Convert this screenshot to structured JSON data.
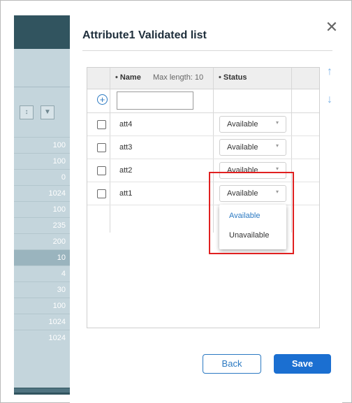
{
  "dialog": {
    "title": "Attribute1 Validated list",
    "close_glyph": "✕"
  },
  "grid": {
    "header": {
      "required_mark": "•",
      "name_label": "Name",
      "max_length_label": "Max length: 10",
      "status_label": "Status"
    },
    "add_glyph": "+",
    "new_name_value": "",
    "rows": [
      {
        "name": "att4",
        "status": "Available"
      },
      {
        "name": "att3",
        "status": "Available"
      },
      {
        "name": "att2",
        "status": "Available"
      },
      {
        "name": "att1",
        "status": "Available"
      }
    ],
    "dropdown": {
      "options": [
        "Available",
        "Unavailable"
      ],
      "highlighted": "Available"
    },
    "chevron_glyph": "▾"
  },
  "side_arrows": {
    "up_glyph": "↑",
    "down_glyph": "↓"
  },
  "buttons": {
    "back_label": "Back",
    "save_label": "Save"
  },
  "background_sheet": {
    "values": [
      "100",
      "100",
      "0",
      "1024",
      "100",
      "235",
      "200",
      "10",
      "4",
      "30",
      "100",
      "1024",
      "1024"
    ],
    "selected_value": "10",
    "filter_icon": "filter-icon",
    "sort_icon": "sort-icon"
  },
  "colors": {
    "accent": "#2b79c2",
    "primary_button": "#1b6fd1",
    "highlight_box": "#e02020",
    "sheet_dark": "#31545f",
    "sheet_light": "#c4d5dc"
  }
}
